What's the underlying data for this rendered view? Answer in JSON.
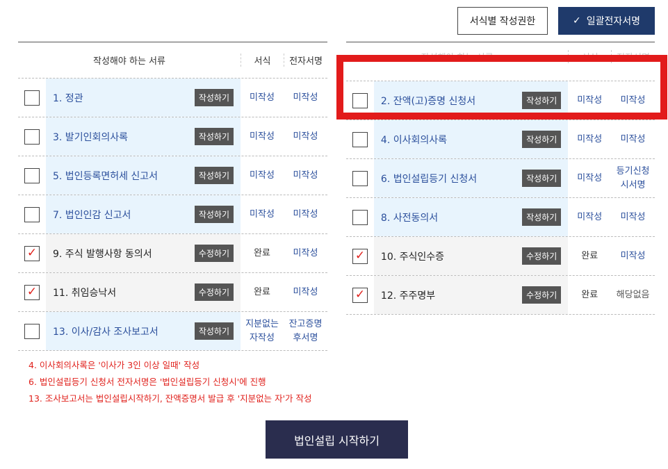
{
  "toolbar": {
    "permission_label": "서식별 작성권한",
    "bulk_sign_label": "일괄전자서명"
  },
  "headers": {
    "documents": "작성해야 하는 서류",
    "form": "서식",
    "signature": "전자서명"
  },
  "left_rows": [
    {
      "title": "1. 정관",
      "action": "작성하기",
      "form": "미작성",
      "sign": "미작성",
      "checked": false
    },
    {
      "title": "3. 발기인회의사록",
      "action": "작성하기",
      "form": "미작성",
      "sign": "미작성",
      "checked": false
    },
    {
      "title": "5. 법인등록면허세 신고서",
      "action": "작성하기",
      "form": "미작성",
      "sign": "미작성",
      "checked": false
    },
    {
      "title": "7. 법인인감 신고서",
      "action": "작성하기",
      "form": "미작성",
      "sign": "미작성",
      "checked": false
    },
    {
      "title": "9. 주식 발행사항 동의서",
      "action": "수정하기",
      "form": "완료",
      "sign": "미작성",
      "checked": true
    },
    {
      "title": "11. 취임승낙서",
      "action": "수정하기",
      "form": "완료",
      "sign": "미작성",
      "checked": true
    },
    {
      "title": "13. 이사/감사 조사보고서",
      "action": "작성하기",
      "form_line1": "지분없는",
      "form_line2": "자작성",
      "sign_line1": "잔고증명",
      "sign_line2": "후서명",
      "checked": false
    }
  ],
  "right_rows": [
    {
      "title": "2. 잔액(고)증명 신청서",
      "action": "작성하기",
      "form": "미작성",
      "sign": "미작성",
      "checked": false
    },
    {
      "title": "4. 이사회의사록",
      "action": "작성하기",
      "form": "미작성",
      "sign": "미작성",
      "checked": false
    },
    {
      "title": "6. 법인설립등기 신청서",
      "action": "작성하기",
      "form": "미작성",
      "sign_line1": "등기신청",
      "sign_line2": "시서명",
      "checked": false
    },
    {
      "title": "8. 사전동의서",
      "action": "작성하기",
      "form": "미작성",
      "sign": "미작성",
      "checked": false
    },
    {
      "title": "10. 주식인수증",
      "action": "수정하기",
      "form": "완료",
      "sign": "미작성",
      "checked": true
    },
    {
      "title": "12. 주주명부",
      "action": "수정하기",
      "form": "완료",
      "sign": "해당없음",
      "checked": true
    }
  ],
  "notes": [
    "4. 이사회의사록은 '이사가 3인 이상 일때' 작성",
    "6. 법인설립등기 신청서 전자서명은 '법인설립등기 신청시'에 진행",
    "13. 조사보고서는 법인설립시작하기, 잔액증명서 발급 후 '지분없는 자'가 작성"
  ],
  "start_button": "법인설립 시작하기",
  "colors": {
    "accent_navy": "#1f3a6b",
    "start_button": "#2a2d4e",
    "highlight_red": "#e21b1b",
    "note_red": "#e0211c",
    "pending_bg": "#e8f4fd"
  }
}
